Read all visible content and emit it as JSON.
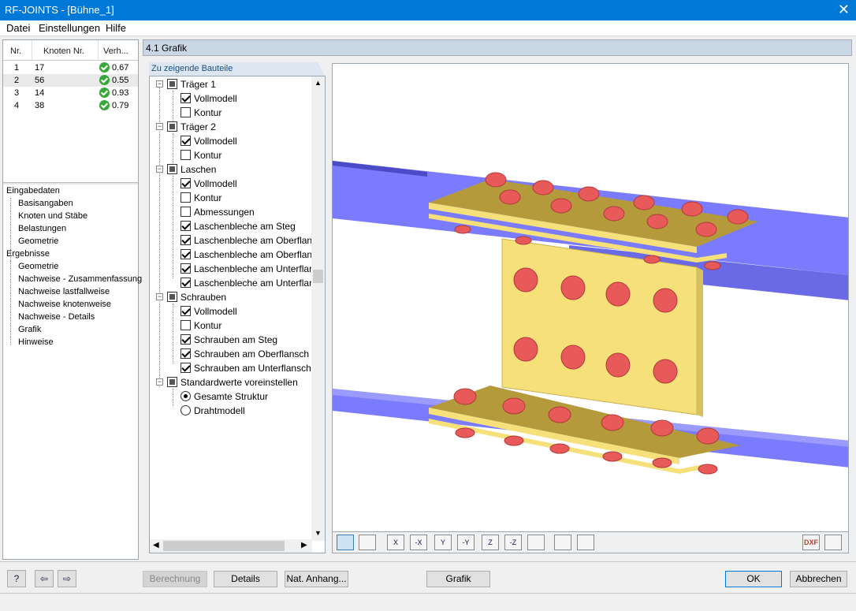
{
  "window": {
    "title": "RF-JOINTS - [Bühne_1]"
  },
  "menu": [
    "Datei",
    "Einstellungen",
    "Hilfe"
  ],
  "nodes_table": {
    "headers": [
      "Nr.",
      "Knoten Nr.",
      "Verh..."
    ],
    "rows": [
      {
        "nr": "1",
        "knoten": "17",
        "verh": "0.67"
      },
      {
        "nr": "2",
        "knoten": "56",
        "verh": "0.55"
      },
      {
        "nr": "3",
        "knoten": "14",
        "verh": "0.93"
      },
      {
        "nr": "4",
        "knoten": "38",
        "verh": "0.79"
      }
    ]
  },
  "nav": {
    "input_group": "Eingabedaten",
    "input_items": [
      "Basisangaben",
      "Knoten und Stäbe",
      "Belastungen",
      "Geometrie"
    ],
    "results_group": "Ergebnisse",
    "results_items": [
      "Geometrie",
      "Nachweise - Zusammenfassung",
      "Nachweise lastfallweise",
      "Nachweise knotenweise",
      "Nachweise - Details",
      "Grafik",
      "Hinweise"
    ]
  },
  "section_title": "4.1 Grafik",
  "tree": {
    "tab_label": "Zu zeigende Bauteile",
    "groups": [
      {
        "label": "Träger 1",
        "items": [
          {
            "label": "Vollmodell",
            "checked": true
          },
          {
            "label": "Kontur",
            "checked": false
          }
        ]
      },
      {
        "label": "Träger 2",
        "items": [
          {
            "label": "Vollmodell",
            "checked": true
          },
          {
            "label": "Kontur",
            "checked": false
          }
        ]
      },
      {
        "label": "Laschen",
        "items": [
          {
            "label": "Vollmodell",
            "checked": true
          },
          {
            "label": "Kontur",
            "checked": false
          },
          {
            "label": "Abmessungen",
            "checked": false
          },
          {
            "label": "Laschenbleche am Steg",
            "checked": true
          },
          {
            "label": "Laschenbleche am Oberflans",
            "checked": true
          },
          {
            "label": "Laschenbleche am Oberflans",
            "checked": true
          },
          {
            "label": "Laschenbleche am Unterflan",
            "checked": true
          },
          {
            "label": "Laschenbleche am Unterflan",
            "checked": true
          }
        ]
      },
      {
        "label": "Schrauben",
        "items": [
          {
            "label": "Vollmodell",
            "checked": true
          },
          {
            "label": "Kontur",
            "checked": false
          },
          {
            "label": "Schrauben am Steg",
            "checked": true
          },
          {
            "label": "Schrauben am Oberflansch",
            "checked": true
          },
          {
            "label": "Schrauben am Unterflansch",
            "checked": true
          }
        ]
      },
      {
        "label": "Standardwerte voreinstellen",
        "radios": [
          {
            "label": "Gesamte Struktur",
            "selected": true
          },
          {
            "label": "Drahtmodell",
            "selected": false
          }
        ]
      }
    ]
  },
  "graphic_toolbar": {
    "buttons": [
      "view-iso-icon",
      "view-text-icon",
      "view-x-icon",
      "view-neg-x-icon",
      "view-y-icon",
      "view-neg-y-icon",
      "view-z-icon",
      "view-neg-z-icon",
      "view-cube-icon",
      "zoom-icon",
      "layers-icon"
    ],
    "labels": [
      "",
      "",
      "X",
      "-X",
      "Y",
      "-Y",
      "Z",
      "-Z",
      "",
      "",
      ""
    ],
    "right": [
      "DXF",
      ""
    ]
  },
  "buttons": {
    "berechnung": "Berechnung",
    "details": "Details",
    "nat_anhang": "Nat. Anhang...",
    "grafik": "Grafik",
    "ok": "OK",
    "abbrechen": "Abbrechen"
  },
  "colors": {
    "titlebar": "#0078d7",
    "beam": "#7b7bff",
    "plate": "#f5e07a",
    "bolt": "#e85a5a",
    "check": "#3aa53a"
  }
}
